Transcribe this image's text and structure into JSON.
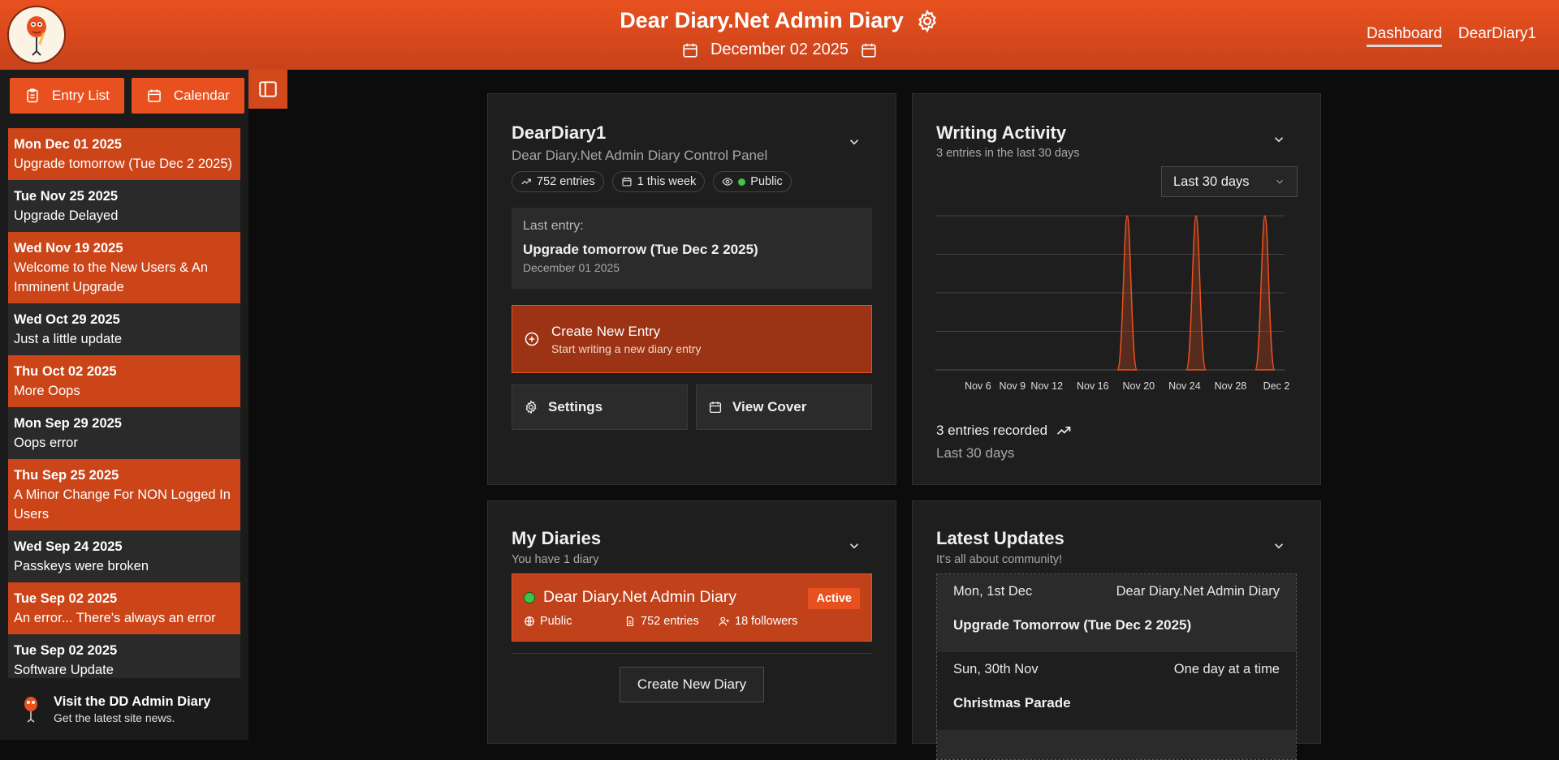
{
  "header": {
    "title": "Dear Diary.Net Admin Diary",
    "date": "December 02 2025",
    "nav": [
      "Dashboard",
      "DearDiary1"
    ]
  },
  "sidebar": {
    "buttons": {
      "entry_list": "Entry List",
      "calendar": "Calendar"
    },
    "entries": [
      {
        "date": "Mon Dec 01 2025",
        "title": "Upgrade tomorrow (Tue Dec 2 2025)",
        "style": "orange"
      },
      {
        "date": "Tue Nov 25 2025",
        "title": "Upgrade Delayed",
        "style": "dark"
      },
      {
        "date": "Wed Nov 19 2025",
        "title": "Welcome to the New Users & An Imminent Upgrade",
        "style": "orange"
      },
      {
        "date": "Wed Oct 29 2025",
        "title": "Just a little update",
        "style": "dark"
      },
      {
        "date": "Thu Oct 02 2025",
        "title": "More Oops",
        "style": "orange"
      },
      {
        "date": "Mon Sep 29 2025",
        "title": "Oops error",
        "style": "dark"
      },
      {
        "date": "Thu Sep 25 2025",
        "title": "A Minor Change For NON Logged In Users",
        "style": "orange"
      },
      {
        "date": "Wed Sep 24 2025",
        "title": "Passkeys were broken",
        "style": "dark"
      },
      {
        "date": "Tue Sep 02 2025",
        "title": "An error... There's always an error",
        "style": "orange"
      },
      {
        "date": "Tue Sep 02 2025",
        "title": "Software Update",
        "style": "dark"
      }
    ],
    "footer": {
      "title": "Visit the DD Admin Diary",
      "subtitle": "Get the latest site news."
    }
  },
  "diary_card": {
    "title": "DearDiary1",
    "subtitle": "Dear Diary.Net Admin Diary Control Panel",
    "chips": {
      "entries": "752 entries",
      "week": "1 this week",
      "visibility": "Public"
    },
    "last_entry": {
      "label": "Last entry:",
      "title": "Upgrade tomorrow (Tue Dec 2 2025)",
      "date": "December 01 2025"
    },
    "create": {
      "title": "Create New Entry",
      "subtitle": "Start writing a new diary entry"
    },
    "settings_label": "Settings",
    "view_cover_label": "View Cover"
  },
  "activity_card": {
    "title": "Writing Activity",
    "subtitle": "3 entries in the last 30 days",
    "range": "Last 30 days",
    "recorded": "3 entries recorded",
    "recorded_sub": "Last 30 days"
  },
  "chart_data": {
    "type": "area",
    "x_ticks": [
      "Nov 6",
      "Nov 9",
      "Nov 12",
      "Nov 16",
      "Nov 20",
      "Nov 24",
      "Nov 28",
      "Dec 2"
    ],
    "series": [
      {
        "x": [
          "Nov 19",
          "Nov 25",
          "Dec 1"
        ],
        "values": [
          1,
          1,
          1
        ]
      }
    ],
    "ylim": [
      0,
      1
    ],
    "grid": true,
    "color": "#e8511f"
  },
  "my_diaries": {
    "title": "My Diaries",
    "subtitle": "You have 1 diary",
    "diary": {
      "name": "Dear Diary.Net Admin Diary",
      "badge": "Active",
      "visibility": "Public",
      "entries": "752 entries",
      "followers": "18 followers"
    },
    "create_label": "Create New Diary"
  },
  "updates_card": {
    "title": "Latest Updates",
    "subtitle": "It's all about community!",
    "items": [
      {
        "date": "Mon, 1st Dec",
        "source": "Dear Diary.Net Admin Diary",
        "title": "Upgrade Tomorrow (Tue Dec 2 2025)"
      },
      {
        "date": "Sun, 30th Nov",
        "source": "One day at a time",
        "title": "Christmas Parade"
      }
    ]
  }
}
